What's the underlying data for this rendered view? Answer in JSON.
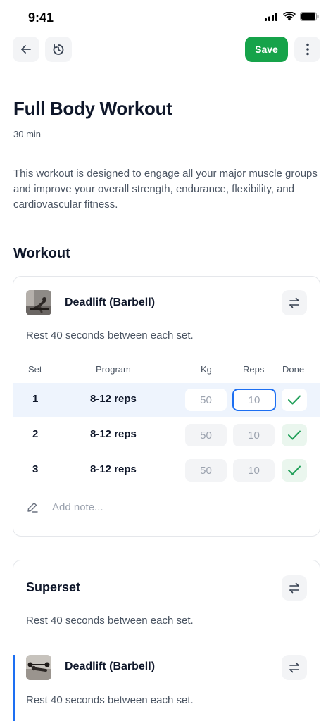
{
  "status_bar": {
    "time": "9:41"
  },
  "header": {
    "save_label": "Save"
  },
  "workout": {
    "title": "Full Body Workout",
    "duration": "30 min",
    "description": "This workout is designed to engage all your major muscle groups and improve your overall strength, endurance, flexibility, and cardiovascular fitness."
  },
  "section_title": "Workout",
  "exercise_card": {
    "name": "Deadlift (Barbell)",
    "rest_text": "Rest 40 seconds between each set.",
    "columns": {
      "set": "Set",
      "program": "Program",
      "kg": "Kg",
      "reps": "Reps",
      "done": "Done"
    },
    "sets": [
      {
        "set": "1",
        "program": "8-12 reps",
        "kg": "50",
        "reps": "10"
      },
      {
        "set": "2",
        "program": "8-12 reps",
        "kg": "50",
        "reps": "10"
      },
      {
        "set": "3",
        "program": "8-12 reps",
        "kg": "50",
        "reps": "10"
      }
    ],
    "note_placeholder": "Add note..."
  },
  "superset_card": {
    "title": "Superset",
    "rest_text": "Rest 40 seconds between each set.",
    "exercise": {
      "name": "Deadlift (Barbell)",
      "rest_text": "Rest 40 seconds between each set."
    }
  },
  "colors": {
    "accent": "#1d6ff2",
    "save": "#16a34a",
    "done_check": "#22a05a"
  },
  "icons": [
    "back-arrow-icon",
    "timer-icon",
    "more-vertical-icon",
    "swap-icon",
    "check-icon",
    "pencil-icon"
  ]
}
